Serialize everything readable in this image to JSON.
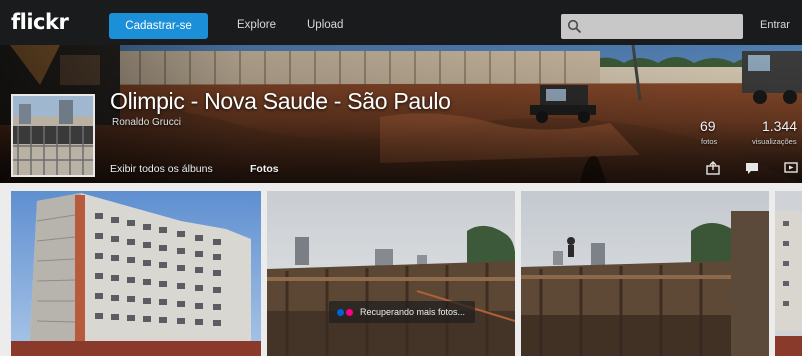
{
  "header": {
    "logo": "flickr",
    "signup_label": "Cadastrar-se",
    "nav": [
      "Explore",
      "Upload"
    ],
    "search": {
      "placeholder": "",
      "icon": "search-icon"
    },
    "signin_label": "Entrar"
  },
  "album": {
    "title": "Olimpic - Nova Saude - São Paulo",
    "owner": "Ronaldo Grucci",
    "tabs": [
      "Exibir todos os álbuns",
      "Fotos"
    ],
    "active_tab": "Fotos",
    "stats": {
      "photos": "69",
      "photos_label": "fotos",
      "views": "1.344",
      "views_label": "visualizações"
    },
    "actions": [
      "share-icon",
      "comment-icon",
      "slideshow-icon"
    ]
  },
  "photos": [
    {
      "subject": "building-under-construction"
    },
    {
      "subject": "construction-site-formwork"
    },
    {
      "subject": "construction-site-worker"
    },
    {
      "subject": "partial-photo"
    }
  ],
  "loading": {
    "text": "Recuperando mais fotos...",
    "dot_colors": [
      "#0063dc",
      "#ff0084"
    ]
  },
  "colors": {
    "topbar": "#191b1d",
    "signup_button": "#1b8fd8",
    "page_background": "#ececec"
  }
}
